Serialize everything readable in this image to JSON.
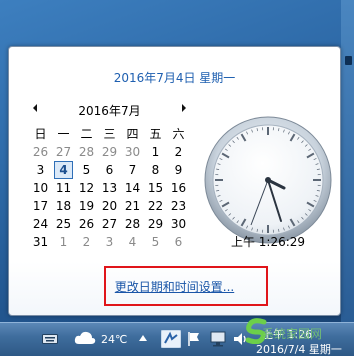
{
  "popup": {
    "full_date": "2016年7月4日 星期一",
    "calendar": {
      "month_title": "2016年7月",
      "weekdays": [
        "日",
        "一",
        "二",
        "三",
        "四",
        "五",
        "六"
      ],
      "rows": [
        [
          "26",
          "27",
          "28",
          "29",
          "30",
          "1",
          "2"
        ],
        [
          "3",
          "4",
          "5",
          "6",
          "7",
          "8",
          "9"
        ],
        [
          "10",
          "11",
          "12",
          "13",
          "14",
          "15",
          "16"
        ],
        [
          "17",
          "18",
          "19",
          "20",
          "21",
          "22",
          "23"
        ],
        [
          "24",
          "25",
          "26",
          "27",
          "28",
          "29",
          "30"
        ],
        [
          "31",
          "1",
          "2",
          "3",
          "4",
          "5",
          "6"
        ]
      ],
      "today": "4"
    },
    "clock": {
      "time_text": "上午 1:26:29"
    },
    "change_settings_link": "更改日期和时间设置..."
  },
  "taskbar": {
    "keyboard_icon": "keyboard-icon",
    "weather_icon": "cloud-icon",
    "temperature": "24℃",
    "show_hidden_icon": "triangle-up-icon",
    "tray_app_icon": "tray-app-icon",
    "tray_flag_icon": "action-center-icon",
    "network_icon": "network-icon",
    "volume_icon": "speaker-icon",
    "clock_time": "上午 1:26",
    "clock_date": "2016/7/4 星期一"
  },
  "watermark": "系统家园网",
  "colors": {
    "link": "#1a56a8",
    "date_header": "#1e5fb0",
    "highlight_box": "#e0151a",
    "today_border": "#2f6fb7"
  }
}
